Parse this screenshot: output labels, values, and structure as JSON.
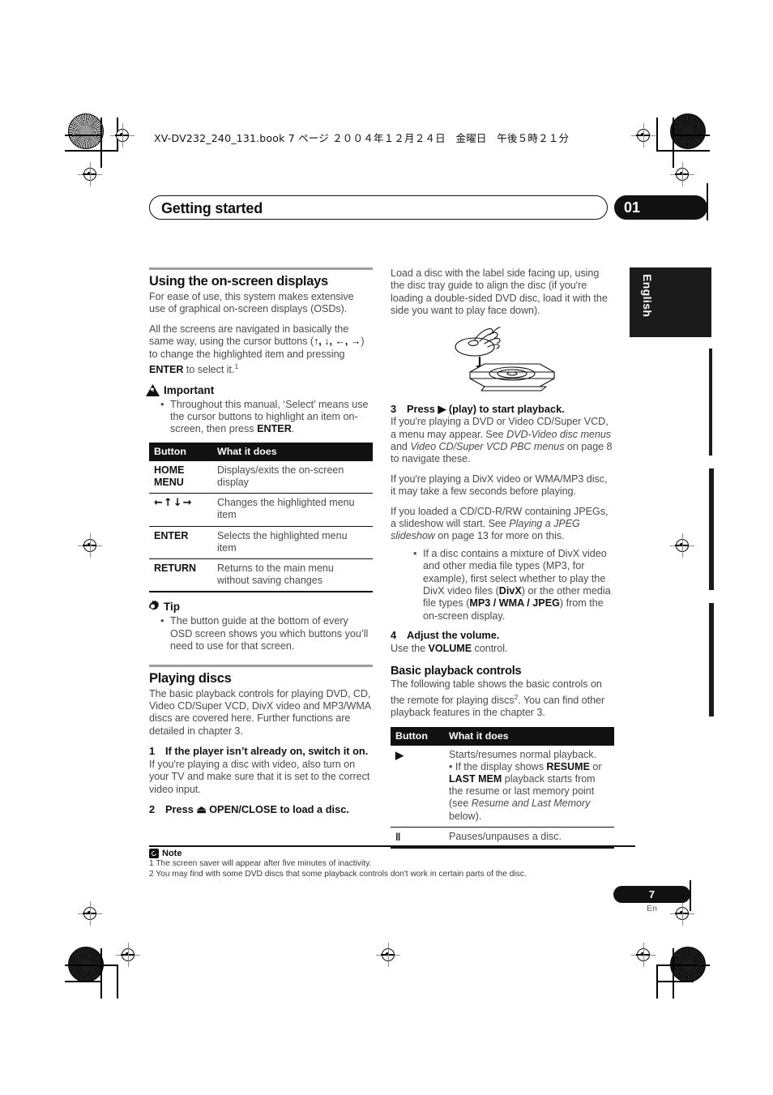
{
  "printer_header": "XV-DV232_240_131.book  7 ページ  ２００４年１２月２４日　金曜日　午後５時２１分",
  "chapter": {
    "title": "Getting started",
    "number": "01"
  },
  "language_tab": "English",
  "left_column": {
    "section1": {
      "heading": "Using the on-screen displays",
      "para1": "For ease of use, this system makes extensive use of graphical on-screen displays (OSDs).",
      "para2_a": "All the screens are navigated in basically the same way, using the cursor buttons (",
      "para2_arrows": "↑, ↓, ←, →",
      "para2_b": ") to change the highlighted item and pressing ",
      "para2_enter": "ENTER",
      "para2_c": " to select it.",
      "para2_fn": "1"
    },
    "important": {
      "label": "Important",
      "bullet_a": "Throughout this manual, ‘Select’ means use the cursor buttons to highlight an item on-screen, then press ",
      "bullet_enter": "ENTER",
      "bullet_b": "."
    },
    "button_table": {
      "headers": [
        "Button",
        "What it does"
      ],
      "rows": [
        {
          "button": "HOME MENU",
          "desc": "Displays/exits the on-screen display"
        },
        {
          "button": "←↑↓→",
          "desc": "Changes the highlighted menu item"
        },
        {
          "button": "ENTER",
          "desc": "Selects the highlighted menu item"
        },
        {
          "button": "RETURN",
          "desc": "Returns to the main menu without saving changes"
        }
      ]
    },
    "tip": {
      "label": "Tip",
      "bullet": "The button guide at the bottom of every OSD screen shows you which buttons you’ll need to use for that screen."
    },
    "section2": {
      "heading": "Playing discs",
      "para1": "The basic playback controls for playing DVD, CD, Video CD/Super VCD, DivX video and MP3/WMA discs are covered here. Further functions are detailed in chapter 3.",
      "step1_num": "1",
      "step1_title": "If the player isn’t already on, switch it on.",
      "step1_body": "If you're playing a disc with video, also turn on your TV and make sure that it is set to the correct video input.",
      "step2_num": "2",
      "step2_title_a": "Press ",
      "step2_title_icon": "⏏",
      "step2_title_b": " OPEN/CLOSE to load a disc."
    }
  },
  "right_column": {
    "load_para": "Load a disc with the label side facing up, using the disc tray guide to align the disc (if you're loading a double-sided DVD disc, load it with the side you want to play face down).",
    "illustration": "hand-loading-disc-into-tray",
    "step3_num": "3",
    "step3_title_a": "Press ",
    "step3_title_icon": "▶",
    "step3_title_b": " (play) to start playback.",
    "step3_p1_a": "If you're playing a DVD or Video CD/Super VCD, a menu may appear. See ",
    "step3_p1_i1": "DVD-Video disc menus",
    "step3_p1_b": " and ",
    "step3_p1_i2": "Video CD/Super VCD PBC menus",
    "step3_p1_c": " on page 8 to navigate these.",
    "step3_p2": "If you're playing a DivX video or WMA/MP3 disc, it may take a few seconds before playing.",
    "step3_p3_a": "If you loaded a CD/CD-R/RW containing JPEGs, a slideshow will start. See ",
    "step3_p3_i": "Playing a JPEG slideshow",
    "step3_p3_b": " on page 13 for more on this.",
    "step3_bullet_a": "If a disc contains a mixture of DivX video and other media file types (MP3, for example), first select whether to play the DivX video files (",
    "step3_bullet_b1": "DivX",
    "step3_bullet_c": ") or the other media file types (",
    "step3_bullet_b2": "MP3 / WMA / JPEG",
    "step3_bullet_d": ") from the on-screen display.",
    "step4_num": "4",
    "step4_title": "Adjust the volume.",
    "step4_body_a": "Use the ",
    "step4_body_b": "VOLUME",
    "step4_body_c": " control.",
    "basic": {
      "heading": "Basic playback controls",
      "para_a": "The following table shows the basic controls on the remote for playing discs",
      "para_fn": "2",
      "para_b": ". You can find other playback features in the chapter 3."
    },
    "playback_table": {
      "headers": [
        "Button",
        "What it does"
      ],
      "rows": [
        {
          "button": "▶",
          "line1": "Starts/resumes normal playback.",
          "bullet_a": "If the display shows ",
          "bullet_b1": "RESUME",
          "bullet_c": " or ",
          "bullet_b2": "LAST MEM",
          "bullet_d": " playback starts from the resume or last memory point (see ",
          "bullet_i": "Resume and Last Memory",
          "bullet_e": " below)."
        },
        {
          "button": "‖",
          "line1": "Pauses/unpauses a disc."
        }
      ]
    }
  },
  "notes": {
    "label": "Note",
    "footnote1": "1 The screen saver will appear after five minutes of inactivity.",
    "footnote2": "2 You may find with some DVD discs that some playback controls don't work in certain parts of the disc."
  },
  "footer": {
    "page_number": "7",
    "page_language": "En"
  }
}
